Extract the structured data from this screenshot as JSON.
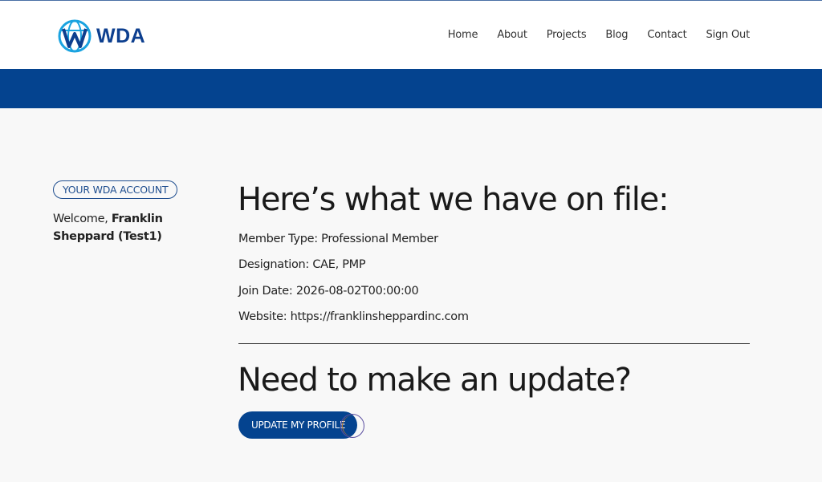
{
  "header": {
    "logo_text": "WDA",
    "nav": [
      "Home",
      "About",
      "Projects",
      "Blog",
      "Contact",
      "Sign Out"
    ]
  },
  "colors": {
    "brand_blue": "#04438f",
    "logo_blue": "#0d3f8f",
    "logo_cyan": "#1aa3e0"
  },
  "sidebar": {
    "badge": "YOUR WDA ACCOUNT",
    "welcome_prefix": "Welcome, ",
    "member_name": "Franklin Sheppard (Test1)"
  },
  "main": {
    "heading": "Here’s what we have on file:",
    "member_type": "Member Type: Professional Member",
    "designation": "Designation: CAE, PMP",
    "join_date": "Join Date: 2026-08-02T00:00:00",
    "website": "Website: https://franklinsheppardinc.com",
    "update_heading": "Need to make an update?",
    "update_button": "UPDATE MY PROFILE"
  }
}
